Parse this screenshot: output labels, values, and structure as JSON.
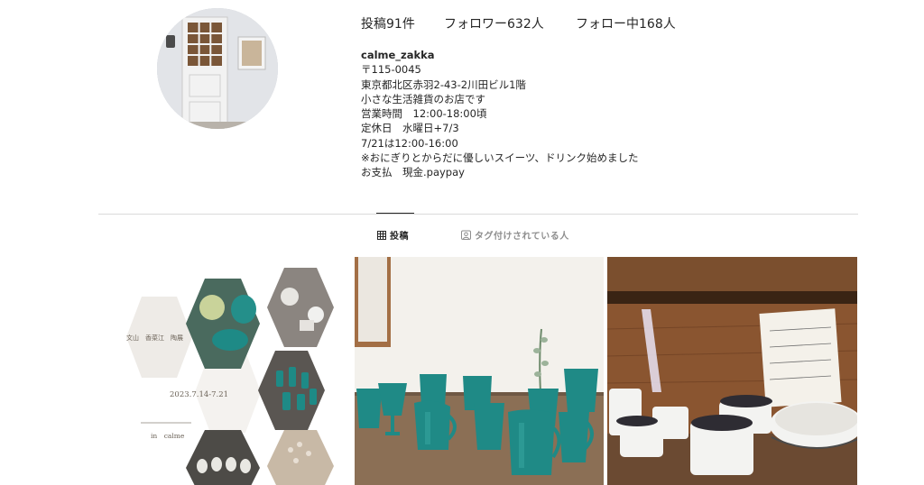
{
  "profile": {
    "stats": {
      "posts": "投稿91件",
      "followers": "フォロワー632人",
      "following": "フォロー中168人"
    },
    "username": "calme_zakka",
    "bio_lines": [
      "〒115-0045",
      "東京都北区赤羽2-43-2川田ビル1階",
      "小さな生活雑貨のお店です",
      "営業時間　12:00-18:00頃",
      "定休日　水曜日+7/3",
      "7/21は12:00-16:00",
      "※おにぎりとからだに優しいスイーツ、ドリンク始めました",
      "お支払　現金.paypay"
    ]
  },
  "tabs": {
    "posts_label": "投稿",
    "tagged_label": "タグ付けされている人"
  },
  "grid": {
    "post1": {
      "artists": "文山　香菜江　陶展",
      "dates": "2023.7.14-7.21",
      "venue": "in　calme"
    }
  },
  "icons": {
    "grid": "grid-icon",
    "tagged": "person-tag-icon"
  },
  "colors": {
    "text": "#262626",
    "muted": "#8e8e8e",
    "divider": "#dbdbdb",
    "turquoise": "#1f8a86"
  }
}
